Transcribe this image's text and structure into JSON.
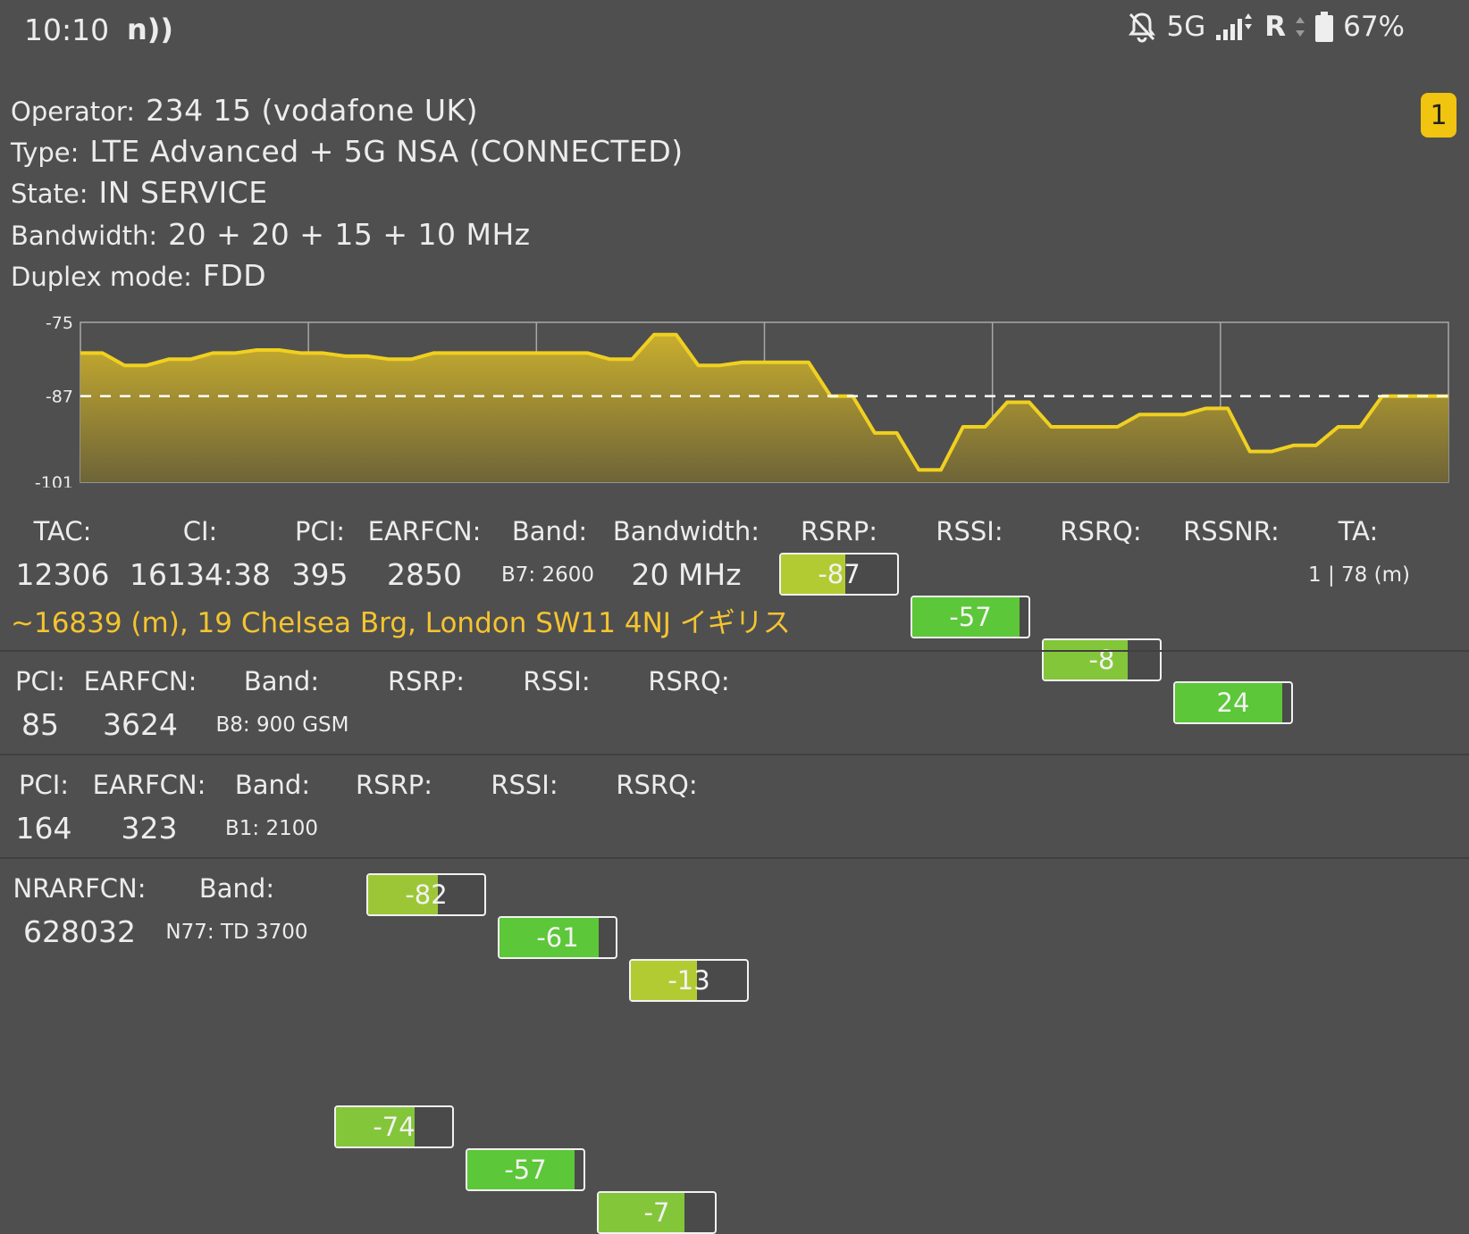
{
  "status_bar": {
    "time": "10:10",
    "nfc_icon": "nfc-icon",
    "network_type": "5G",
    "roaming": "R",
    "battery": "67%"
  },
  "operator_info": {
    "operator_label": "Operator:",
    "operator_value": "234 15 (vodafone UK)",
    "type_label": "Type:",
    "type_value": "LTE Advanced + 5G NSA (CONNECTED)",
    "state_label": "State:",
    "state_value": "IN SERVICE",
    "bandwidth_label": "Bandwidth:",
    "bandwidth_value": "20 + 20 + 15 + 10 MHz",
    "duplex_label": "Duplex mode:",
    "duplex_value": "FDD",
    "badge": "1"
  },
  "chart_data": {
    "type": "area",
    "title": "",
    "xlabel": "",
    "ylabel": "",
    "ylim": [
      -101,
      -75
    ],
    "yticks": [
      -75,
      -87,
      -101
    ],
    "reference_line": -87,
    "grid": true,
    "color": "#f0d020",
    "x": [
      0,
      1,
      2,
      3,
      4,
      5,
      6,
      7,
      8,
      9,
      10,
      11,
      12,
      13,
      14,
      15,
      16,
      17,
      18,
      19,
      20,
      21,
      22,
      23,
      24,
      25,
      26,
      27,
      28,
      29,
      30,
      31,
      32,
      33,
      34,
      35,
      36,
      37,
      38,
      39,
      40,
      41,
      42,
      43,
      44,
      45,
      46,
      47,
      48,
      49,
      50,
      51,
      52,
      53,
      54,
      55,
      56,
      57,
      58,
      59,
      60,
      61,
      62
    ],
    "series": [
      {
        "values": [
          -80,
          -80,
          -82,
          -82,
          -81,
          -81,
          -80,
          -80,
          -79.5,
          -79.5,
          -80,
          -80,
          -80.5,
          -80.5,
          -81,
          -81,
          -80,
          -80,
          -80,
          -80,
          -80,
          -80,
          -80,
          -80,
          -81,
          -81,
          -77,
          -77,
          -82,
          -82,
          -81.5,
          -81.5,
          -81.5,
          -81.5,
          -87,
          -87,
          -93,
          -93,
          -99,
          -99,
          -92,
          -92,
          -88,
          -88,
          -92,
          -92,
          -92,
          -92,
          -90,
          -90,
          -90,
          -89,
          -89,
          -96,
          -96,
          -95,
          -95,
          -92,
          -92,
          -87,
          -87,
          -87,
          -87
        ]
      }
    ]
  },
  "serving_cell": {
    "headers": {
      "tac": "TAC:",
      "ci": "CI:",
      "pci": "PCI:",
      "earfcn": "EARFCN:",
      "band": "Band:",
      "bandwidth": "Bandwidth:",
      "rsrp": "RSRP:",
      "rssi": "RSSI:",
      "rsrq": "RSRQ:",
      "rssnr": "RSSNR:",
      "ta": "TA:"
    },
    "values": {
      "tac": "12306",
      "ci": "16134:38",
      "pci": "395",
      "earfcn": "2850",
      "band": "B7: 2600",
      "bandwidth": "20 MHz",
      "ta": "1 | 78 (m)"
    },
    "meters": {
      "rsrp": {
        "label": "-87",
        "fill": 0.55,
        "color": "#b3cb33"
      },
      "rssi": {
        "label": "-57",
        "fill": 0.92,
        "color": "#5cc738"
      },
      "rsrq": {
        "label": "-8",
        "fill": 0.72,
        "color": "#84c63a"
      },
      "rssnr": {
        "label": "24",
        "fill": 0.92,
        "color": "#5cc738"
      }
    },
    "address": "~16839 (m), 19 Chelsea Brg, London SW11 4NJ イギリス"
  },
  "neighbor_cells": [
    {
      "headers": {
        "pci": "PCI:",
        "earfcn": "EARFCN:",
        "band": "Band:",
        "rsrp": "RSRP:",
        "rssi": "RSSI:",
        "rsrq": "RSRQ:"
      },
      "values": {
        "pci": "85",
        "earfcn": "3624",
        "band": "B8: 900 GSM"
      },
      "meters": {
        "rsrp": {
          "label": "-82",
          "fill": 0.6,
          "color": "#9dc636"
        },
        "rssi": {
          "label": "-61",
          "fill": 0.85,
          "color": "#5cc738"
        },
        "rsrq": {
          "label": "-13",
          "fill": 0.57,
          "color": "#b3cb33"
        }
      }
    },
    {
      "headers": {
        "pci": "PCI:",
        "earfcn": "EARFCN:",
        "band": "Band:",
        "rsrp": "RSRP:",
        "rssi": "RSSI:",
        "rsrq": "RSRQ:"
      },
      "values": {
        "pci": "164",
        "earfcn": "323",
        "band": "B1: 2100"
      },
      "meters": {
        "rsrp": {
          "label": "-74",
          "fill": 0.68,
          "color": "#84c63a"
        },
        "rssi": {
          "label": "-57",
          "fill": 0.92,
          "color": "#5cc738"
        },
        "rsrq": {
          "label": "-7",
          "fill": 0.74,
          "color": "#84c63a"
        }
      }
    }
  ],
  "nr_cell": {
    "headers": {
      "nrarfcn": "NRARFCN:",
      "band": "Band:"
    },
    "values": {
      "nrarfcn": "628032",
      "band": "N77: TD 3700"
    }
  }
}
